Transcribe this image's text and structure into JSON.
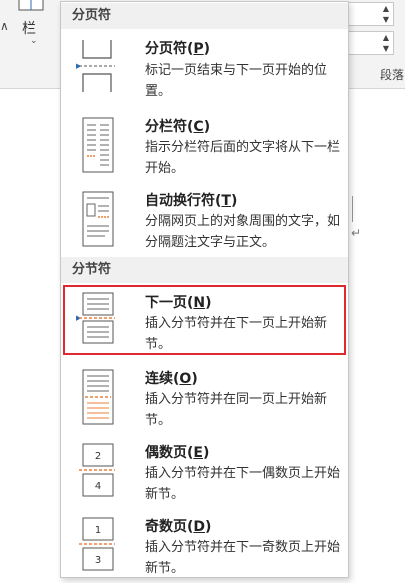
{
  "ribbon": {
    "columns_label": "栏",
    "columns_caret": "⌄",
    "partial_left": "∧",
    "paragraph_group_label": "段落"
  },
  "menu": {
    "sections": [
      {
        "header": "分页符",
        "items": [
          {
            "title": "分页符",
            "shortcut": "P",
            "desc": "标记一页结束与下一页开始的位置。",
            "icon": "page-break-icon"
          },
          {
            "title": "分栏符",
            "shortcut": "C",
            "desc": "指示分栏符后面的文字将从下一栏开始。",
            "icon": "column-break-icon"
          },
          {
            "title": "自动换行符",
            "shortcut": "T",
            "desc": "分隔网页上的对象周围的文字，如分隔题注文字与正文。",
            "icon": "text-wrapping-break-icon"
          }
        ]
      },
      {
        "header": "分节符",
        "items": [
          {
            "title": "下一页",
            "shortcut": "N",
            "desc": "插入分节符并在下一页上开始新节。",
            "icon": "next-page-section-icon",
            "selected": true
          },
          {
            "title": "连续",
            "shortcut": "O",
            "desc": "插入分节符并在同一页上开始新节。",
            "icon": "continuous-section-icon"
          },
          {
            "title": "偶数页",
            "shortcut": "E",
            "desc": "插入分节符并在下一偶数页上开始新节。",
            "icon": "even-page-section-icon",
            "page_nums": [
              "2",
              "4"
            ]
          },
          {
            "title": "奇数页",
            "shortcut": "D",
            "desc": "插入分节符并在下一奇数页上开始新节。",
            "icon": "odd-page-section-icon",
            "page_nums": [
              "1",
              "3"
            ]
          }
        ]
      }
    ]
  },
  "colors": {
    "highlight_border": "#e0282e",
    "accent": "#2b6bb5",
    "section_bg": "#f0f0f0",
    "icon_orange": "#e8823a"
  }
}
